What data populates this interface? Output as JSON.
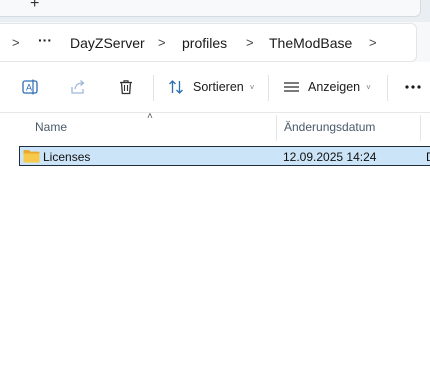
{
  "tabstrip": {
    "new_tab_symbol": "+"
  },
  "breadcrumb": {
    "more": "···",
    "items": [
      "DayZServer",
      "profiles",
      "TheModBase"
    ],
    "separator": ">"
  },
  "toolbar": {
    "sort_label": "Sortieren",
    "view_label": "Anzeigen",
    "more_symbol": "···",
    "caret": "˅"
  },
  "columns": {
    "name": "Name",
    "date": "Änderungsdatum",
    "sort_indicator": "˄"
  },
  "files": [
    {
      "name": "Licenses",
      "date": "12.09.2025 14:24",
      "type_partial": "D",
      "selected": true
    }
  ],
  "colors": {
    "selection_bg": "#cce4f7",
    "selection_border": "#1f2d3d",
    "folder_yellow": "#f3c242",
    "accent_blue": "#2d6db5"
  }
}
